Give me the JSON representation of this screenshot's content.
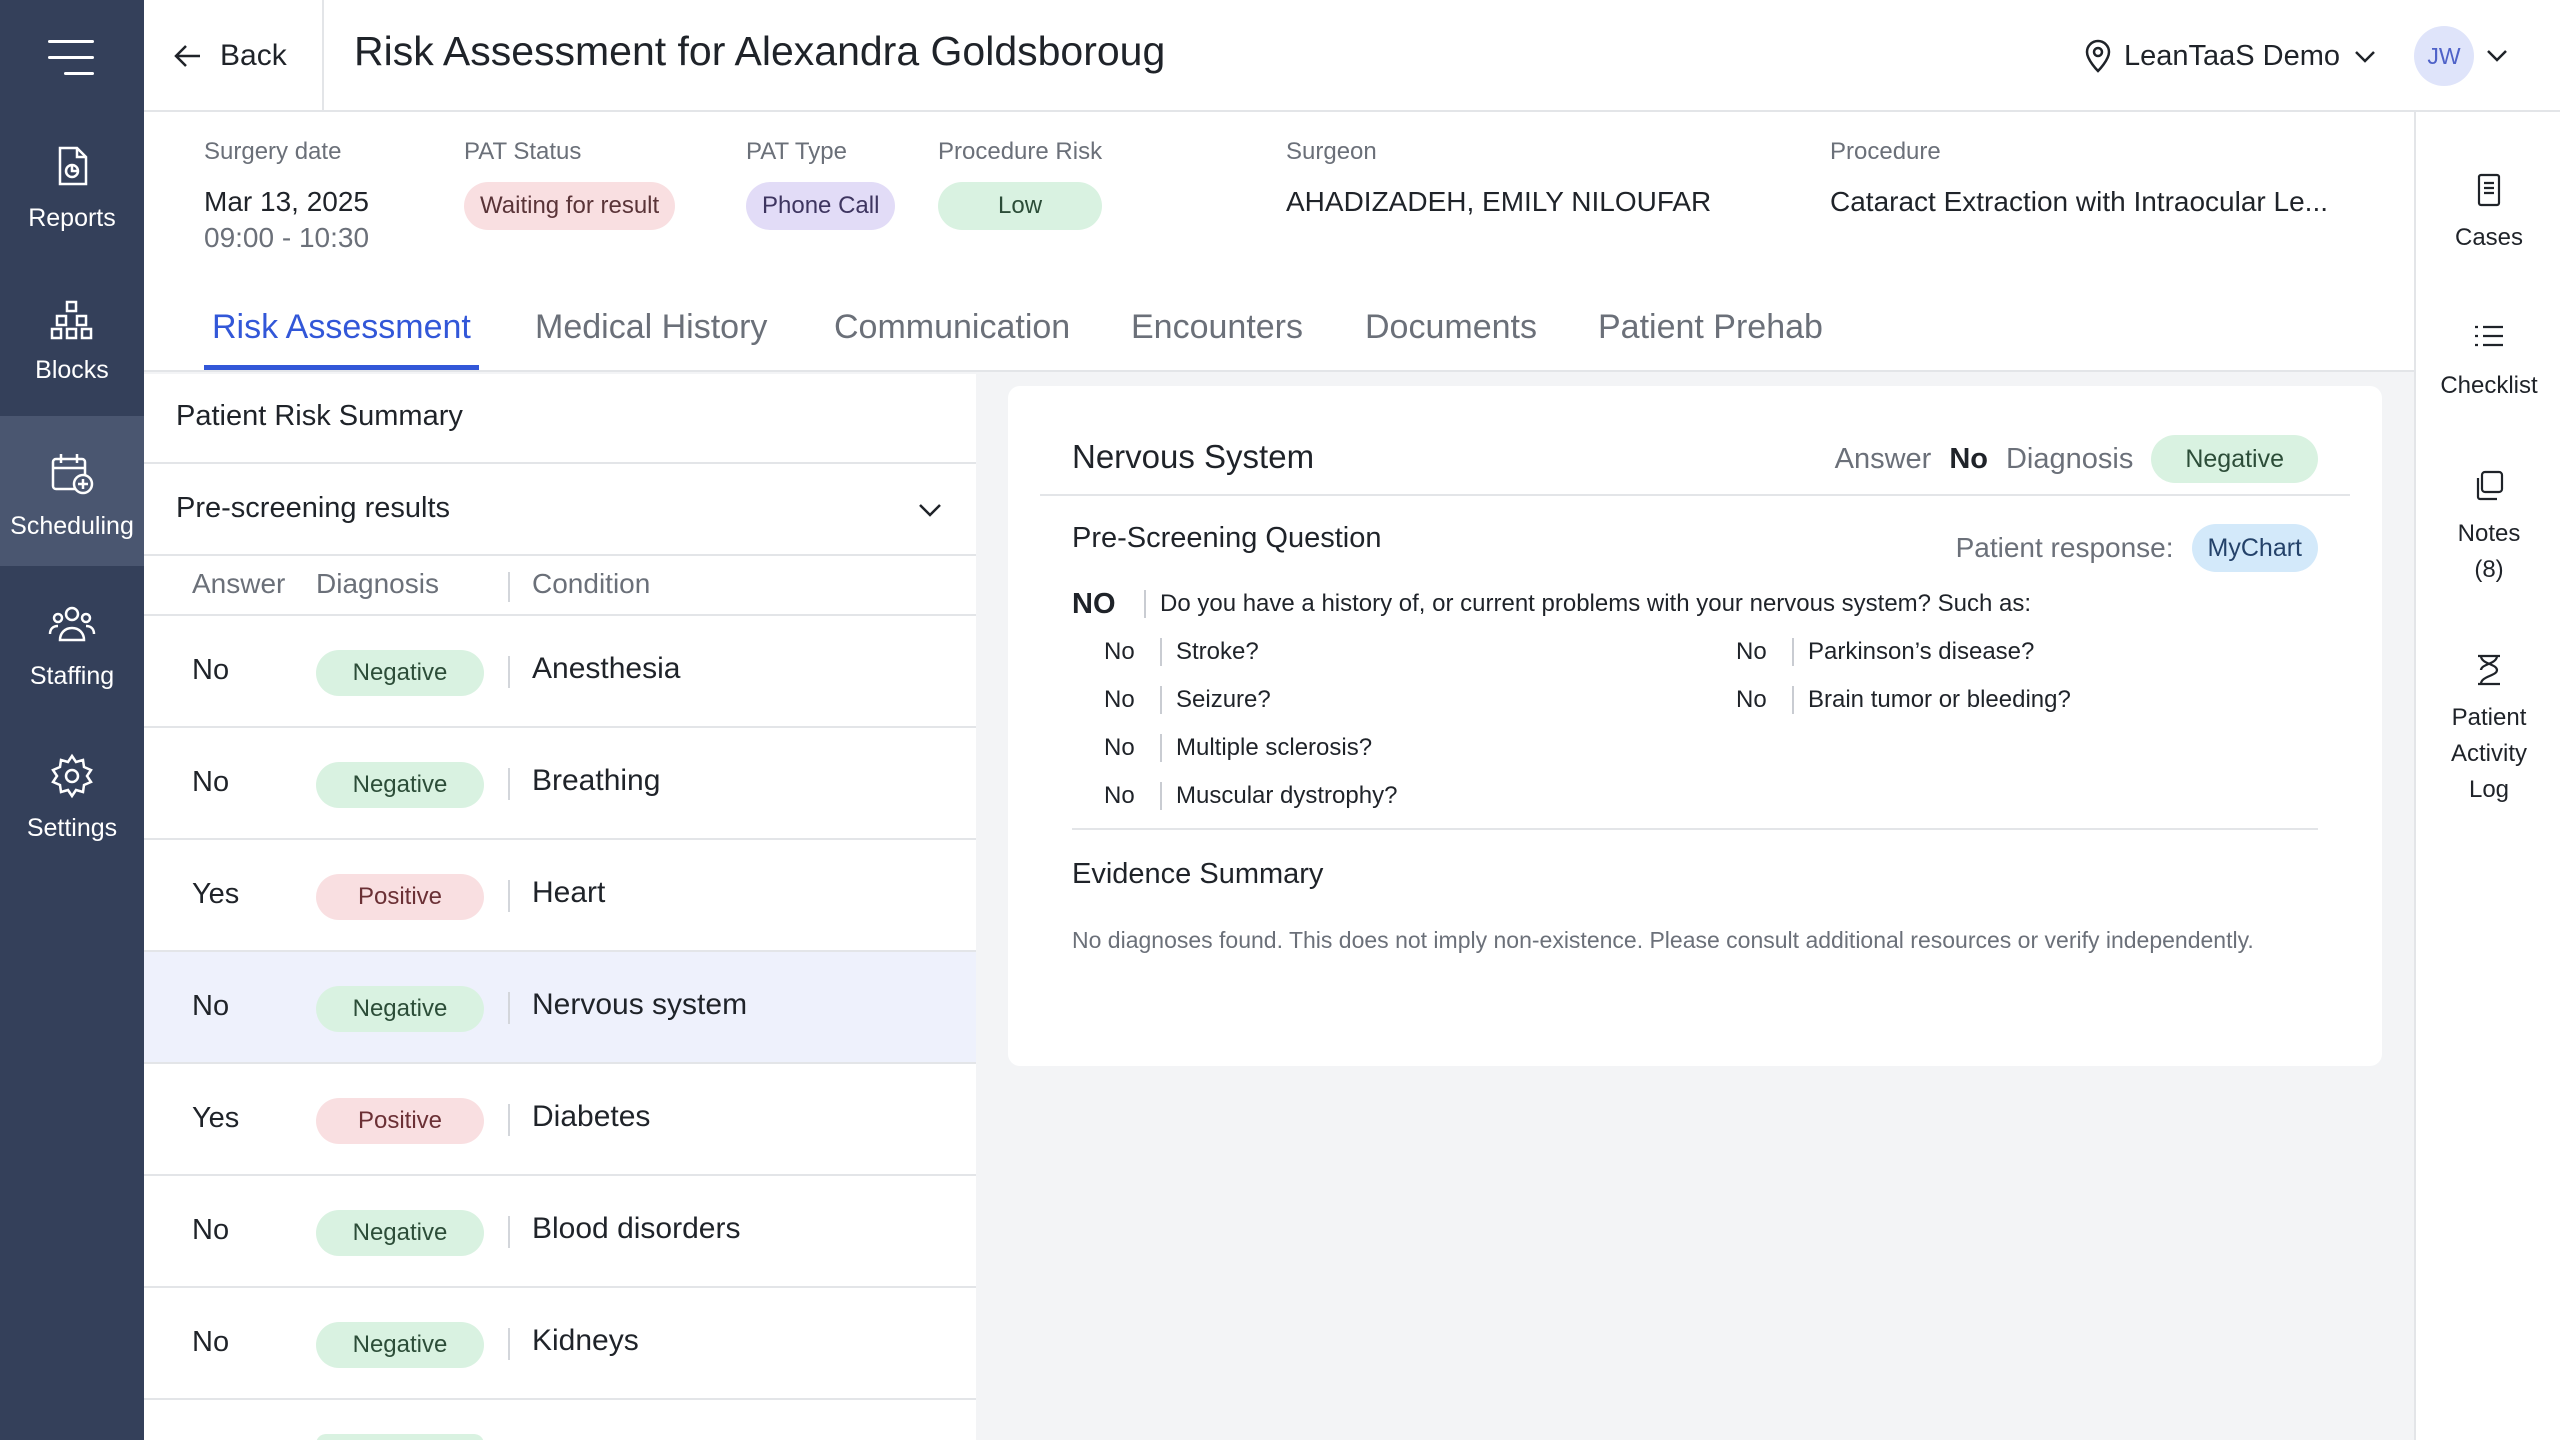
{
  "nav": {
    "items": [
      {
        "label": "Reports",
        "icon": "reports-icon"
      },
      {
        "label": "Blocks",
        "icon": "blocks-icon"
      },
      {
        "label": "Scheduling",
        "icon": "scheduling-icon"
      },
      {
        "label": "Staffing",
        "icon": "staffing-icon"
      },
      {
        "label": "Settings",
        "icon": "gear-icon"
      }
    ],
    "active": "Scheduling",
    "bg_color": "#34405a"
  },
  "topbar": {
    "back_label": "Back",
    "title": "Risk Assessment for Alexandra Goldsboroug",
    "org": "LeanTaaS Demo",
    "avatar_initials": "JW"
  },
  "header": {
    "surgery_date": {
      "label": "Surgery date",
      "date": "Mar 13, 2025",
      "time": "09:00 - 10:30"
    },
    "pat_status": {
      "label": "PAT Status",
      "value": "Waiting for result"
    },
    "pat_type": {
      "label": "PAT Type",
      "value": "Phone Call"
    },
    "procedure_risk": {
      "label": "Procedure Risk",
      "value": "Low"
    },
    "surgeon": {
      "label": "Surgeon",
      "value": "AHADIZADEH, EMILY NILOUFAR"
    },
    "procedure": {
      "label": "Procedure",
      "value": "Cataract Extraction with Intraocular Le..."
    }
  },
  "tabs": [
    "Risk Assessment",
    "Medical History",
    "Communication",
    "Encounters",
    "Documents",
    "Patient Prehab"
  ],
  "active_tab": "Risk Assessment",
  "right_panel": {
    "cases": "Cases",
    "checklist": "Checklist",
    "notes": "Notes",
    "notes_count": "(8)",
    "activity_line1": "Patient",
    "activity_line2": "Activity",
    "activity_line3": "Log"
  },
  "left": {
    "summary_title": "Patient Risk Summary",
    "prescreen_title": "Pre-screening results",
    "columns": {
      "answer": "Answer",
      "diagnosis": "Diagnosis",
      "condition": "Condition"
    },
    "rows": [
      {
        "answer": "No",
        "diagnosis": "Negative",
        "condition": "Anesthesia"
      },
      {
        "answer": "No",
        "diagnosis": "Negative",
        "condition": "Breathing"
      },
      {
        "answer": "Yes",
        "diagnosis": "Positive",
        "condition": "Heart"
      },
      {
        "answer": "No",
        "diagnosis": "Negative",
        "condition": "Nervous system"
      },
      {
        "answer": "Yes",
        "diagnosis": "Positive",
        "condition": "Diabetes"
      },
      {
        "answer": "No",
        "diagnosis": "Negative",
        "condition": "Blood disorders"
      },
      {
        "answer": "No",
        "diagnosis": "Negative",
        "condition": "Kidneys"
      }
    ],
    "selected_index": 3
  },
  "detail": {
    "title": "Nervous System",
    "answer_label": "Answer",
    "answer_value": "No",
    "diagnosis_label": "Diagnosis",
    "diagnosis_value": "Negative",
    "prescreen_label": "Pre-Screening Question",
    "response_label": "Patient response:",
    "response_value": "MyChart",
    "main_answer": "NO",
    "main_question": "Do you have a history of, or current problems with your nervous system? Such as:",
    "sub_left": [
      {
        "answer": "No",
        "question": "Stroke?"
      },
      {
        "answer": "No",
        "question": "Seizure?"
      },
      {
        "answer": "No",
        "question": "Multiple sclerosis?"
      },
      {
        "answer": "No",
        "question": "Muscular dystrophy?"
      }
    ],
    "sub_right": [
      {
        "answer": "No",
        "question": "Parkinson’s disease?"
      },
      {
        "answer": "No",
        "question": "Brain tumor or bleeding?"
      }
    ],
    "evidence_title": "Evidence Summary",
    "evidence_text": "No diagnoses found. This does not imply non-existence. Please consult additional resources or verify independently."
  },
  "colors": {
    "accent": "#3257d8",
    "negative_bg": "#d9f2e1",
    "positive_bg": "#f9dfe1"
  }
}
